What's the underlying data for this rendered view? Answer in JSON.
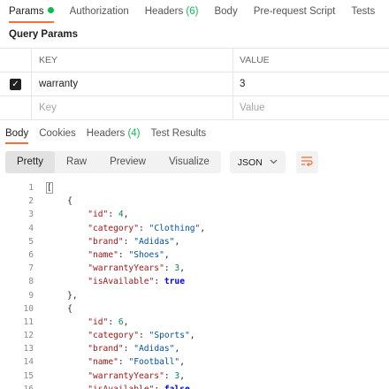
{
  "request_tabs": [
    {
      "label": "Params",
      "active": true,
      "dot": true
    },
    {
      "label": "Authorization"
    },
    {
      "label": "Headers",
      "count": "(6)"
    },
    {
      "label": "Body"
    },
    {
      "label": "Pre-request Script"
    },
    {
      "label": "Tests"
    }
  ],
  "query_params": {
    "title": "Query Params",
    "headers": {
      "key": "KEY",
      "value": "VALUE"
    },
    "rows": [
      {
        "checked": true,
        "key": "warranty",
        "value": "3"
      }
    ],
    "new_row": {
      "key_placeholder": "Key",
      "value_placeholder": "Value"
    }
  },
  "response_tabs": [
    {
      "label": "Body",
      "active": true
    },
    {
      "label": "Cookies"
    },
    {
      "label": "Headers",
      "count": "(4)"
    },
    {
      "label": "Test Results"
    }
  ],
  "view_modes": [
    "Pretty",
    "Raw",
    "Preview",
    "Visualize"
  ],
  "active_view_mode": "Pretty",
  "format": "JSON",
  "colors": {
    "accent": "#ff6c37",
    "success": "#0cbb52"
  },
  "code_lines": [
    {
      "n": "1",
      "t": "[",
      "type": "open-array"
    },
    {
      "n": "2",
      "t": "{",
      "indent": 1
    },
    {
      "n": "3",
      "indent": 2,
      "key": "id",
      "val": "4",
      "vt": "n"
    },
    {
      "n": "4",
      "indent": 2,
      "key": "category",
      "val": "\"Clothing\"",
      "vt": "s"
    },
    {
      "n": "5",
      "indent": 2,
      "key": "brand",
      "val": "\"Adidas\"",
      "vt": "s"
    },
    {
      "n": "6",
      "indent": 2,
      "key": "name",
      "val": "\"Shoes\"",
      "vt": "s"
    },
    {
      "n": "7",
      "indent": 2,
      "key": "warrantyYears",
      "val": "3",
      "vt": "n"
    },
    {
      "n": "8",
      "indent": 2,
      "key": "isAvailable",
      "val": "true",
      "vt": "b",
      "last": true
    },
    {
      "n": "9",
      "t": "},",
      "indent": 1
    },
    {
      "n": "10",
      "t": "{",
      "indent": 1
    },
    {
      "n": "11",
      "indent": 2,
      "key": "id",
      "val": "6",
      "vt": "n"
    },
    {
      "n": "12",
      "indent": 2,
      "key": "category",
      "val": "\"Sports\"",
      "vt": "s"
    },
    {
      "n": "13",
      "indent": 2,
      "key": "brand",
      "val": "\"Adidas\"",
      "vt": "s"
    },
    {
      "n": "14",
      "indent": 2,
      "key": "name",
      "val": "\"Football\"",
      "vt": "s"
    },
    {
      "n": "15",
      "indent": 2,
      "key": "warrantyYears",
      "val": "3",
      "vt": "n"
    },
    {
      "n": "16",
      "indent": 2,
      "key": "isAvailable",
      "val": "false",
      "vt": "b",
      "last": true
    }
  ]
}
